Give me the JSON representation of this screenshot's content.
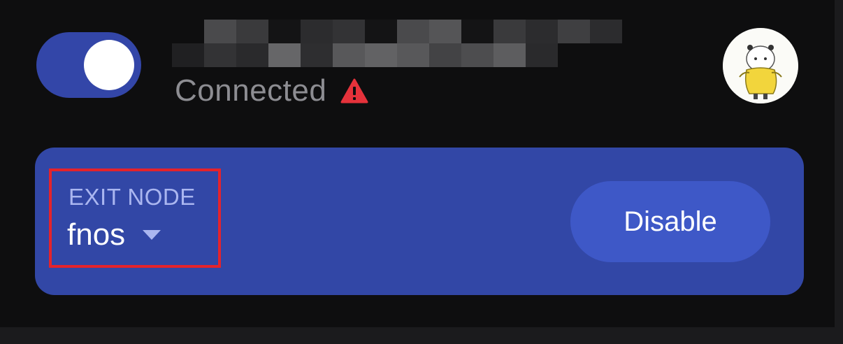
{
  "vpn": {
    "toggle_state": "on",
    "status_text": "Connected",
    "status_icon": "warning-icon",
    "warning_color": "#e5323b"
  },
  "header": {
    "title_redacted": true,
    "avatar_icon": "avatar-illustration"
  },
  "exit_node": {
    "label": "EXIT NODE",
    "value": "fnos",
    "dropdown_icon": "caret-down-icon",
    "disable_label": "Disable"
  },
  "colors": {
    "background": "#0e0e0f",
    "accent": "#3346a8",
    "card": "#3247a6",
    "button": "#3e58c7",
    "highlight_border": "#e5232b"
  }
}
